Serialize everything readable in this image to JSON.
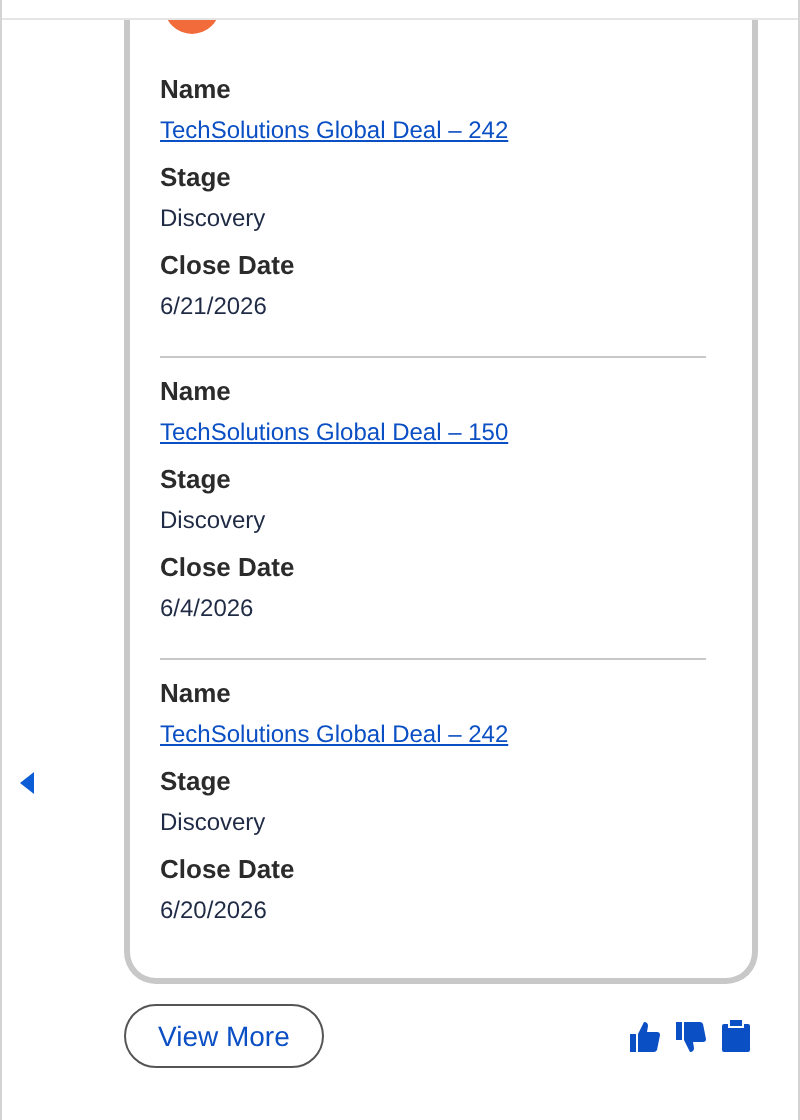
{
  "records": [
    {
      "fields": [
        {
          "label": "Name",
          "value": "TechSolutions Global Deal – 242",
          "kind": "link"
        },
        {
          "label": "Stage",
          "value": "Discovery",
          "kind": "text"
        },
        {
          "label": "Close Date",
          "value": "6/21/2026",
          "kind": "text"
        }
      ]
    },
    {
      "fields": [
        {
          "label": "Name",
          "value": "TechSolutions Global Deal – 150",
          "kind": "link"
        },
        {
          "label": "Stage",
          "value": "Discovery",
          "kind": "text"
        },
        {
          "label": "Close Date",
          "value": "6/4/2026",
          "kind": "text"
        }
      ]
    },
    {
      "fields": [
        {
          "label": "Name",
          "value": "TechSolutions Global Deal – 242",
          "kind": "link"
        },
        {
          "label": "Stage",
          "value": "Discovery",
          "kind": "text"
        },
        {
          "label": "Close Date",
          "value": "6/20/2026",
          "kind": "text"
        }
      ]
    }
  ],
  "view_more": "View More"
}
